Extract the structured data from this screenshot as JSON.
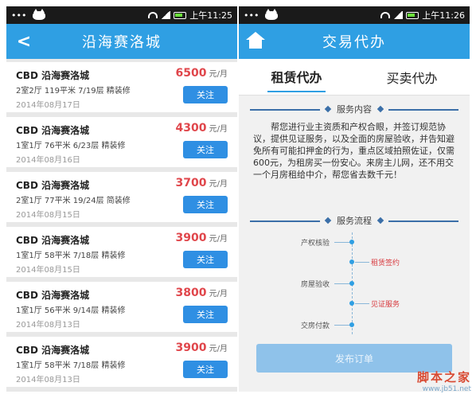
{
  "left": {
    "status": {
      "time": "上午11:25"
    },
    "navbar": {
      "title": "沿海赛洛城"
    },
    "items": [
      {
        "title": "CBD  沿海赛洛城",
        "price": "6500",
        "unit": " 元/月",
        "meta": "2室2厅   119平米   7/19层   精装修",
        "date": "2014年08月17日",
        "button": "关注"
      },
      {
        "title": "CBD  沿海赛洛城",
        "price": "4300",
        "unit": " 元/月",
        "meta": "1室1厅   76平米   6/23层   精装修",
        "date": "2014年08月16日",
        "button": "关注"
      },
      {
        "title": "CBD  沿海赛洛城",
        "price": "3700",
        "unit": " 元/月",
        "meta": "2室1厅   77平米   19/24层   简装修",
        "date": "2014年08月15日",
        "button": "关注"
      },
      {
        "title": "CBD  沿海赛洛城",
        "price": "3900",
        "unit": " 元/月",
        "meta": "1室1厅   58平米   7/18层   精装修",
        "date": "2014年08月15日",
        "button": "关注"
      },
      {
        "title": "CBD  沿海赛洛城",
        "price": "3800",
        "unit": " 元/月",
        "meta": "1室1厅   56平米   9/14层   精装修",
        "date": "2014年08月13日",
        "button": "关注"
      },
      {
        "title": "CBD  沿海赛洛城",
        "price": "3900",
        "unit": " 元/月",
        "meta": "1室1厅   58平米   7/18层   精装修",
        "date": "2014年08月13日",
        "button": "关注"
      }
    ]
  },
  "right": {
    "status": {
      "time": "上午11:26"
    },
    "navbar": {
      "title": "交易代办"
    },
    "tabs": [
      {
        "label": "租赁代办"
      },
      {
        "label": "买卖代办"
      }
    ],
    "service": {
      "heading": "服务内容",
      "text": "帮您进行业主资质和产权合眼，并签订规范协议，提供见证服务，以及全面的房屋验收，并告知避免所有可能扣押金的行为，重点区域拍照佐证，仅需600元，为租房买一份安心。来房主儿网，还不用交一个月房租给中介，帮您省去数千元！"
    },
    "flow": {
      "heading": "服务流程",
      "steps": [
        {
          "label": "产权核验"
        },
        {
          "label": "租赁签约"
        },
        {
          "label": "房屋验收"
        },
        {
          "label": "见证服务"
        },
        {
          "label": "交房付款"
        }
      ]
    },
    "publish": {
      "label": "发布订单"
    }
  },
  "watermark": {
    "main": "脚本之家",
    "sub": "www.jb51.net"
  },
  "icons": {
    "back": "back-arrow-icon",
    "home": "home-icon",
    "wifi": "wifi-icon",
    "signal": "signal-icon",
    "battery": "battery-icon",
    "notification": "cat-notification-icon"
  },
  "colors": {
    "primary": "#2f9fe3",
    "price": "#e0464b",
    "flow_highlight": "#d83a3f"
  }
}
